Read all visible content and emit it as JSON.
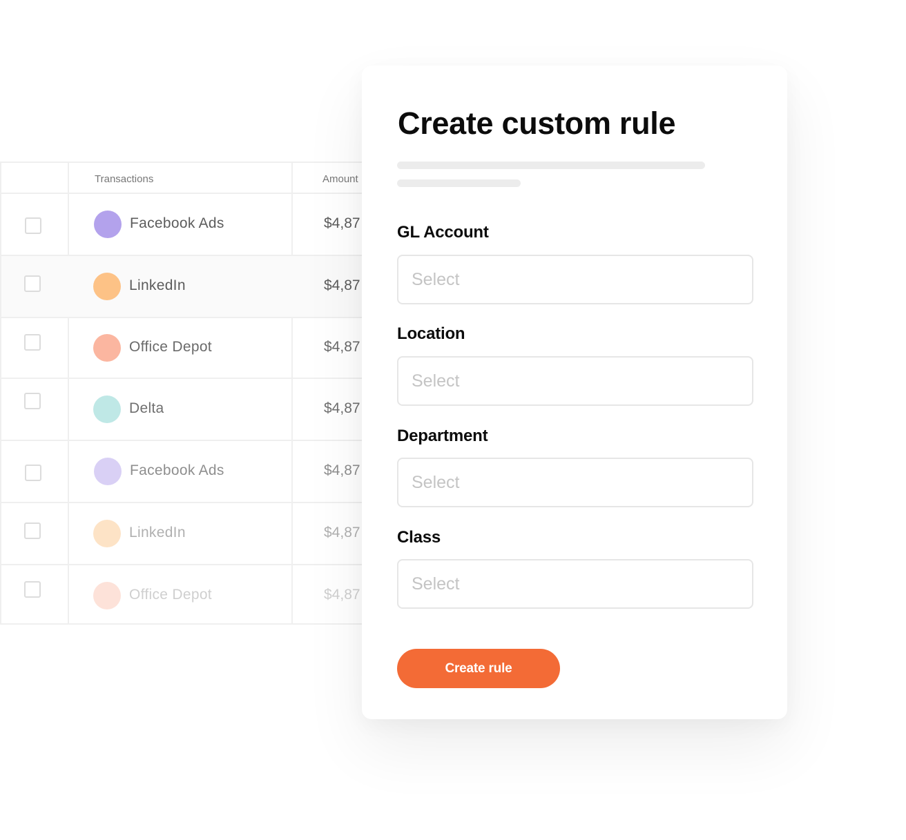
{
  "table": {
    "headers": {
      "transactions": "Transactions",
      "amount": "Amount"
    },
    "rows": [
      {
        "vendor": "Facebook Ads",
        "amount": "$4,87",
        "dot_color": "#b3a2ec",
        "text_color": "#5c5c5c"
      },
      {
        "vendor": "LinkedIn",
        "amount": "$4,87",
        "dot_color": "#fdc286",
        "text_color": "#5c5c5c"
      },
      {
        "vendor": "Office Depot",
        "amount": "$4,87",
        "dot_color": "#fbb6a0",
        "text_color": "#6a6a6a"
      },
      {
        "vendor": "Delta",
        "amount": "$4,87",
        "dot_color": "#bfe8e6",
        "text_color": "#6f6f6f"
      },
      {
        "vendor": "Facebook Ads",
        "amount": "$4,87",
        "dot_color": "#d9d0f5",
        "text_color": "#8e8e8e"
      },
      {
        "vendor": "LinkedIn",
        "amount": "$4,87",
        "dot_color": "#fde3c6",
        "text_color": "#b0b0b0"
      },
      {
        "vendor": "Office Depot",
        "amount": "$4,87",
        "dot_color": "#fde2d9",
        "text_color": "#cfcfcf"
      }
    ]
  },
  "modal": {
    "title": "Create custom rule",
    "fields": [
      {
        "label": "GL Account",
        "placeholder": "Select"
      },
      {
        "label": "Location",
        "placeholder": "Select"
      },
      {
        "label": "Department",
        "placeholder": "Select"
      },
      {
        "label": "Class",
        "placeholder": "Select"
      }
    ],
    "submit_label": "Create rule"
  },
  "colors": {
    "accent": "#f36b36",
    "border": "#efefef",
    "placeholder": "#c4c4c4"
  }
}
